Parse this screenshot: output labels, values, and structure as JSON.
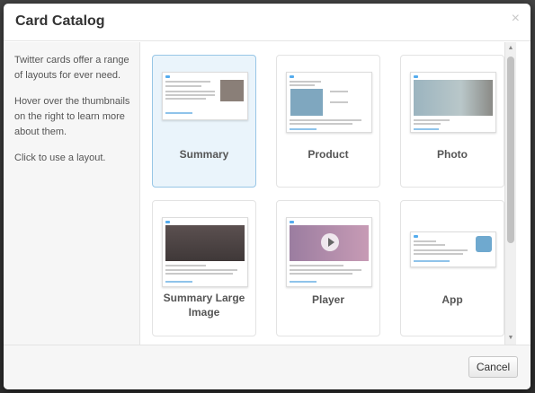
{
  "modal": {
    "title": "Card Catalog",
    "close_symbol": "×"
  },
  "sidebar": {
    "intro": "Twitter cards offer a range of layouts for ever need.",
    "hover_hint": "Hover over the thumbnails on the right to learn more about them.",
    "click_hint": "Click to use a layout."
  },
  "cards": [
    {
      "label": "Summary",
      "selected": true,
      "icon": "summary-thumbnail"
    },
    {
      "label": "Product",
      "selected": false,
      "icon": "product-thumbnail"
    },
    {
      "label": "Photo",
      "selected": false,
      "icon": "photo-thumbnail"
    },
    {
      "label": "Summary Large Image",
      "selected": false,
      "icon": "summary-large-image-thumbnail"
    },
    {
      "label": "Player",
      "selected": false,
      "icon": "player-thumbnail"
    },
    {
      "label": "App",
      "selected": false,
      "icon": "app-thumbnail"
    }
  ],
  "footer": {
    "cancel_label": "Cancel"
  },
  "colors": {
    "selected_bg": "#eaf4fb",
    "selected_border": "#98c6e6",
    "twitter_blue": "#55acee"
  }
}
